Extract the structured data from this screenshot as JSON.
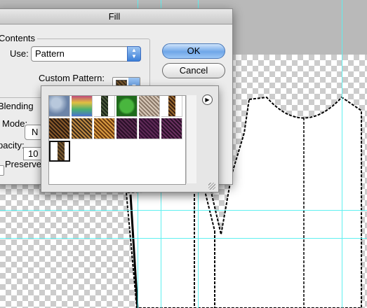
{
  "dialog": {
    "title": "Fill",
    "contents_group": "Contents",
    "use_label": "Use:",
    "use_value": "Pattern",
    "custom_pattern_label": "Custom Pattern:",
    "ok_label": "OK",
    "cancel_label": "Cancel",
    "blending_group": "Blending",
    "mode_label": "Mode:",
    "mode_value": "N",
    "opacity_label": "pacity:",
    "opacity_value": "10",
    "preserve_label": "Preserve"
  },
  "pattern_popup": {
    "options_icon": "right-arrow-circle-icon",
    "patterns": [
      {
        "name": "bubbles",
        "colors": [
          "#6c84a8",
          "#b8c8dc"
        ]
      },
      {
        "name": "tie-dye",
        "colors": [
          "#d04a7a",
          "#6ac04a"
        ]
      },
      {
        "name": "dark-weave",
        "colors": [
          "#1a2418",
          "#4a5a3c"
        ]
      },
      {
        "name": "green-sphere",
        "colors": [
          "#1f6a1c",
          "#49b63e"
        ]
      },
      {
        "name": "lace",
        "colors": [
          "#d8c8b8",
          "#8a7868"
        ]
      },
      {
        "name": "brown-stripe-narrow",
        "colors": [
          "#3a2010",
          "#9a6a30"
        ]
      },
      {
        "name": "brown-texture",
        "colors": [
          "#2a1a10",
          "#8a5a2a"
        ]
      },
      {
        "name": "gold-fabric",
        "colors": [
          "#3a2a1a",
          "#c08a40"
        ]
      },
      {
        "name": "orange-weave",
        "colors": [
          "#6a3a10",
          "#d89a40"
        ]
      },
      {
        "name": "purple-mesh-1",
        "colors": [
          "#2a1028",
          "#5a2a50"
        ]
      },
      {
        "name": "purple-mesh-2",
        "colors": [
          "#301030",
          "#602a58"
        ]
      },
      {
        "name": "purple-mesh-3",
        "colors": [
          "#2a1028",
          "#6a3060"
        ]
      },
      {
        "name": "selected-pattern",
        "colors": [
          "#3a2a18",
          "#7a5a30"
        ]
      }
    ]
  },
  "accent_colors": {
    "guides": "#5ff0f0",
    "default_button": "#6fa6e8"
  }
}
